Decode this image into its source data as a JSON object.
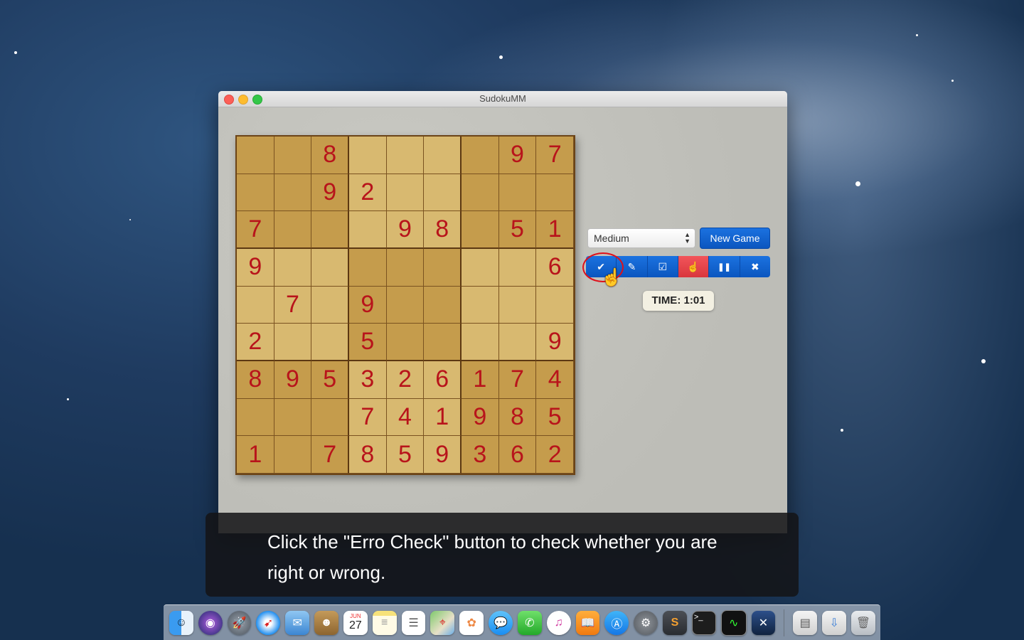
{
  "window": {
    "title": "SudokuMM"
  },
  "board": [
    [
      "",
      "",
      "8",
      "",
      "",
      "",
      "",
      "9",
      "7"
    ],
    [
      "",
      "",
      "9",
      "2",
      "",
      "",
      "",
      "",
      ""
    ],
    [
      "7",
      "",
      "",
      "",
      "9",
      "8",
      "",
      "5",
      "1"
    ],
    [
      "9",
      "",
      "",
      "",
      "",
      "",
      "",
      "",
      "6"
    ],
    [
      "",
      "7",
      "",
      "9",
      "",
      "",
      "",
      "",
      ""
    ],
    [
      "2",
      "",
      "",
      "5",
      "",
      "",
      "",
      "",
      "9"
    ],
    [
      "8",
      "9",
      "5",
      "3",
      "2",
      "6",
      "1",
      "7",
      "4"
    ],
    [
      "",
      "",
      "",
      "7",
      "4",
      "1",
      "9",
      "8",
      "5"
    ],
    [
      "1",
      "",
      "7",
      "8",
      "5",
      "9",
      "3",
      "6",
      "2"
    ]
  ],
  "controls": {
    "difficulty": "Medium",
    "new_game_label": "New Game",
    "timer": "TIME: 1:01",
    "toolbar_icons": [
      "checkmark-icon",
      "pencil-icon",
      "edit-check-icon",
      "hand-pointer-icon",
      "pause-icon",
      "close-icon"
    ]
  },
  "caption": {
    "text": "Click the \"Erro Check\" button to check whether you are right or wrong."
  },
  "dock": {
    "icons": [
      "finder-icon",
      "siri-icon",
      "launchpad-icon",
      "safari-icon",
      "mail-icon",
      "contacts-icon",
      "calendar-icon",
      "notes-icon",
      "reminders-icon",
      "maps-icon",
      "photos-icon",
      "messages-icon",
      "facetime-icon",
      "itunes-icon",
      "ibooks-icon",
      "app-store-icon",
      "system-preferences-icon",
      "sublime-text-icon",
      "terminal-icon",
      "activity-monitor-icon",
      "xquartz-icon",
      "documents-folder-icon",
      "downloads-folder-icon",
      "trash-icon"
    ],
    "calendar_month": "JUN",
    "calendar_day": "27"
  },
  "colors": {
    "digit": "#b8141b",
    "button_blue": "#0b56bf",
    "button_red": "#d9363d",
    "board_light": "#d8b970",
    "board_dark": "#c59c4c"
  }
}
